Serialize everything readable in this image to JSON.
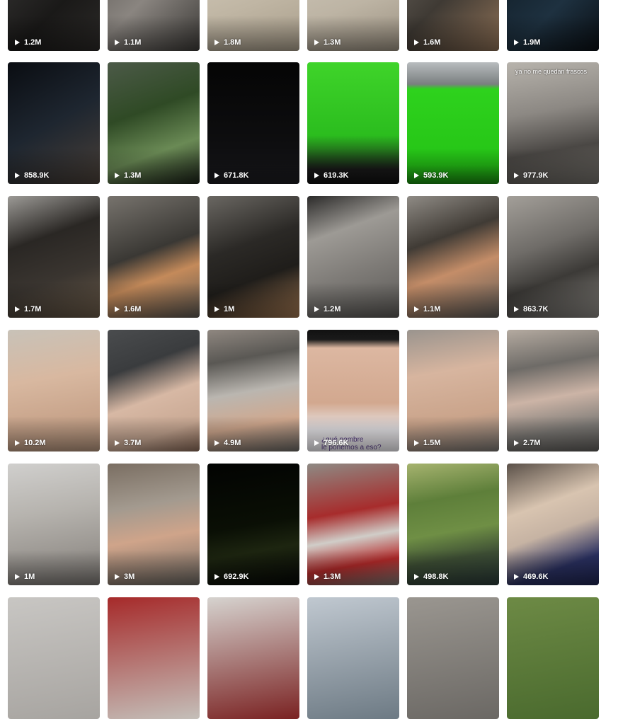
{
  "grid": {
    "videos": [
      {
        "views": "1.2M",
        "bg": "linear-gradient(135deg,#3b3a39,#1a1918 60%,#2b2927)"
      },
      {
        "views": "1.1M",
        "bg": "linear-gradient(135deg,#5a5753,#8a8580 50%,#3c3a37)"
      },
      {
        "views": "1.8M",
        "bg": "linear-gradient(160deg,#d9d1c2,#bfb5a3 60%,#a89d8a)"
      },
      {
        "views": "1.3M",
        "bg": "linear-gradient(160deg,#d3ccbf,#bdb4a4 60%,#9b9181)"
      },
      {
        "views": "1.6M",
        "bg": "linear-gradient(135deg,#6b655e,#3f3a34 50%,#8c6f55)"
      },
      {
        "views": "1.9M",
        "bg": "linear-gradient(135deg,#0d1820,#1e3140 60%,#0a0f14)"
      },
      {
        "views": "858.9K",
        "bg": "linear-gradient(150deg,#0a0d12,#1e2630 50%,#4a4038)"
      },
      {
        "views": "1.3M",
        "bg": "linear-gradient(160deg,#4c5a48,#2f4a25 40%,#6a8a55 70%,#1b2218)"
      },
      {
        "views": "671.8K",
        "bg": "linear-gradient(180deg,#050505,#0e0e10 70%,#1c1c20)"
      },
      {
        "views": "619.3K",
        "bg": "linear-gradient(180deg,#3fd42a,#2bbd1e 60%,#1a1a1a 88%,#111)"
      },
      {
        "views": "593.9K",
        "bg": "linear-gradient(180deg,#b8bcbe,#7a7f80 18%,#2ed21d 22%,#25c416 85%,#1a8a10)"
      },
      {
        "views": "977.9K",
        "bg": "linear-gradient(170deg,#b7b3ac,#8c8883 40%,#4a4744 70%,#73706a)",
        "caption": "ya no me quedan frascos"
      },
      {
        "views": "1.7M",
        "bg": "linear-gradient(160deg,#9c9a96,#2a2724 35%,#3a3530 65%,#6a5a48)"
      },
      {
        "views": "1.6M",
        "bg": "linear-gradient(160deg,#77736d,#3a3834 45%,#c48a5a 65%,#5a5650)"
      },
      {
        "views": "1M",
        "bg": "linear-gradient(160deg,#6a6762,#2b2926 40%,#1f1d1a 65%,#a07650)"
      },
      {
        "views": "1.2M",
        "bg": "linear-gradient(160deg,#2b2a29,#9d9a95 30%,#7f7c78 60%,#5a5855)"
      },
      {
        "views": "1.1M",
        "bg": "linear-gradient(160deg,#8f8b85,#403b35 35%,#c48d68 60%,#5c5a57)"
      },
      {
        "views": "863.7K",
        "bg": "linear-gradient(160deg,#a39f99,#6f6c68 40%,#3c3a37 65%,#8a8782)"
      },
      {
        "views": "10.2M",
        "bg": "linear-gradient(170deg,#c8c2b8,#d8b8a0 40%,#c9a58c 70%,#b4947c)"
      },
      {
        "views": "3.7M",
        "bg": "linear-gradient(160deg,#4a4c4e,#3a3c3e 30%,#d7b8a4 55%,#c9a994 80%,#8a6a58)"
      },
      {
        "views": "4.9M",
        "bg": "linear-gradient(170deg,#8f8780,#5a5854 25%,#bab6b0 50%,#d0a88e 75%,#6a6864)"
      },
      {
        "views": "796.6K",
        "bg": "linear-gradient(180deg,#111,#1a1a1a 8%,#dcb7a1 15%,#d2a88f 60%,#e9e7ea 82%,#f2f0f4)",
        "subtitle": "¿qué nombre\nle ponemos a eso?"
      },
      {
        "views": "1.5M",
        "bg": "linear-gradient(170deg,#9a948e,#d7b59f 35%,#caa48b 70%,#7a7672)"
      },
      {
        "views": "2.7M",
        "bg": "linear-gradient(170deg,#b4aaa0,#6e6b67 30%,#ccb4a6 55%,#7f7c78 80%,#5e5c59)"
      },
      {
        "views": "1M",
        "bg": "linear-gradient(170deg,#d0cfcd,#b6b3ae 40%,#9c9893 70%,#7a7672)"
      },
      {
        "views": "3M",
        "bg": "linear-gradient(170deg,#7a6e62,#a39a8f 35%,#cfa48a 60%,#6c6862)"
      },
      {
        "views": "692.9K",
        "bg": "linear-gradient(170deg,#020302,#0a0f05 50%,#1d2510 70%,#050705)"
      },
      {
        "views": "1.3M",
        "bg": "linear-gradient(170deg,#8e8a84,#a72c2c 40%,#d0cdc8 60%,#b52a2a 80%,#7a7570)"
      },
      {
        "views": "498.8K",
        "bg": "linear-gradient(170deg,#a6b36f,#5e7f3a 30%,#6f8f45 55%,#3e4f35 75%,#2a3a38)"
      },
      {
        "views": "469.6K",
        "bg": "linear-gradient(160deg,#5a5048,#d8c4b0 35%,#c6b3a3 55%,#2a3060 80%,#1e2450)"
      },
      {
        "views": "",
        "bg": "linear-gradient(170deg,#c8c6c3,#a7a4a0)"
      },
      {
        "views": "",
        "bg": "linear-gradient(170deg,#a62a2a,#c4bfb9)"
      },
      {
        "views": "",
        "bg": "linear-gradient(170deg,#d6d3cf,#7a2222)"
      },
      {
        "views": "",
        "bg": "linear-gradient(170deg,#c0c8d0,#6d7a84)"
      },
      {
        "views": "",
        "bg": "linear-gradient(170deg,#9a9690,#6b6864)"
      },
      {
        "views": "",
        "bg": "linear-gradient(170deg,#6d8a45,#4a6a2e)"
      }
    ]
  }
}
